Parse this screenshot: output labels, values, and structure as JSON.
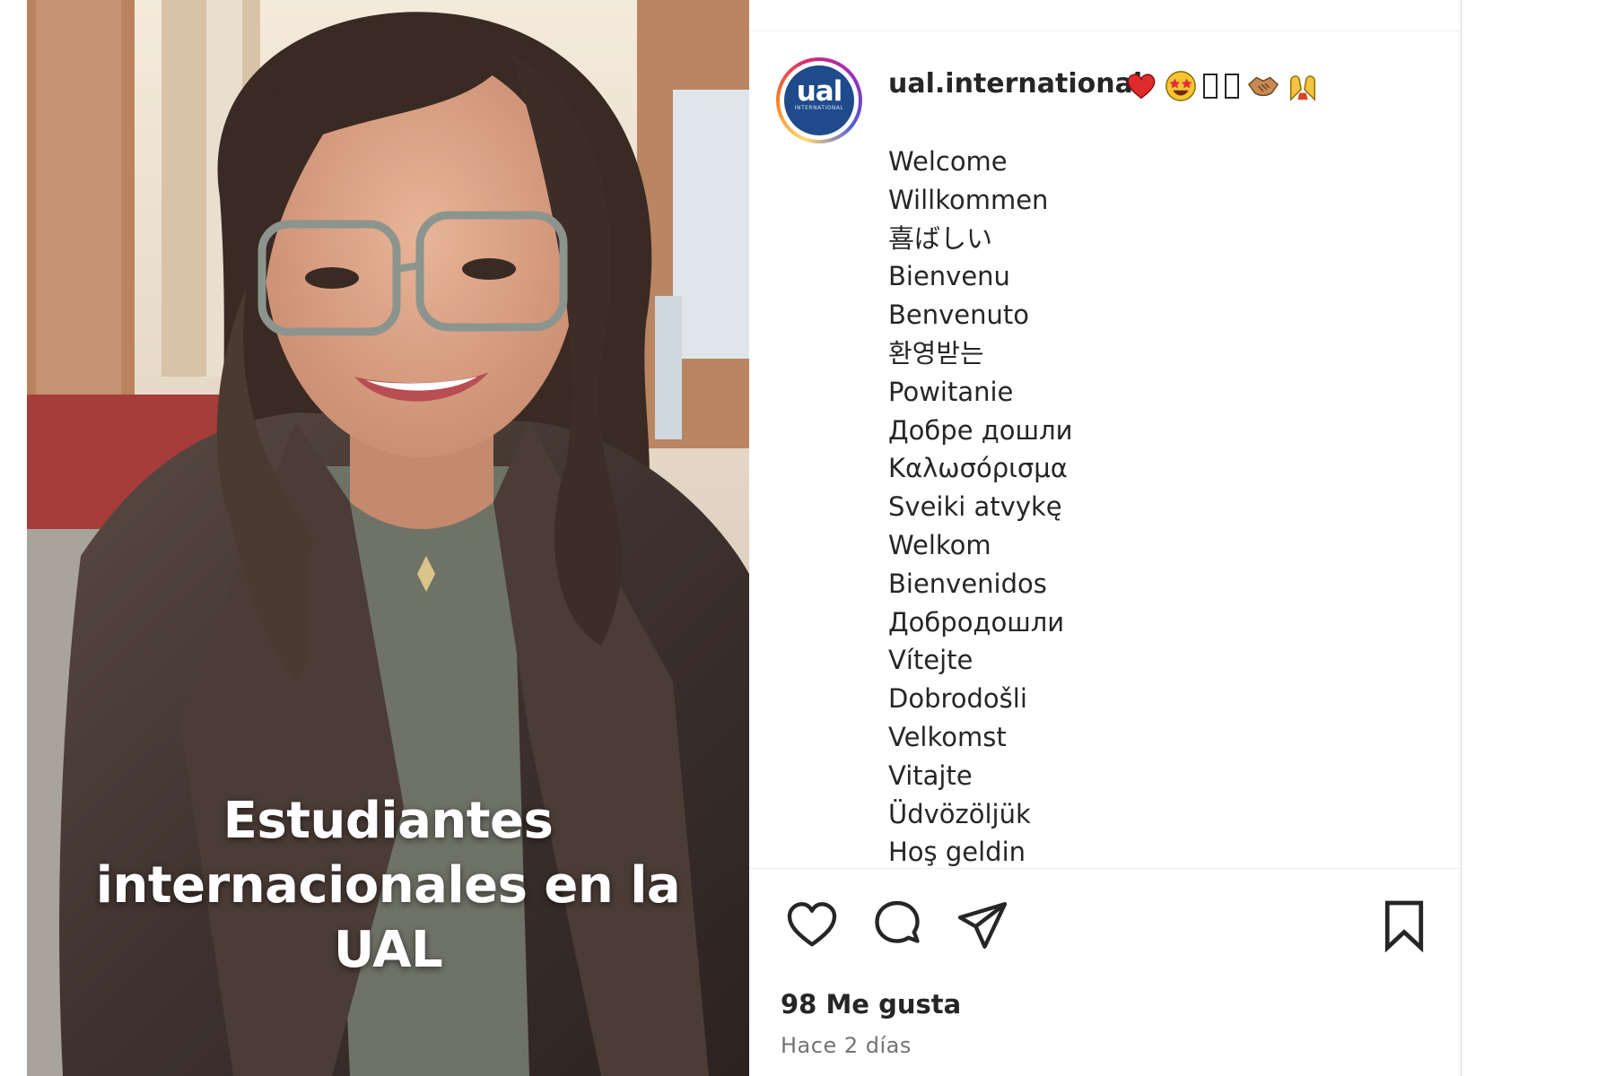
{
  "media": {
    "overlay_lines": [
      "Estudiantes",
      "internacionales en la",
      "UAL"
    ]
  },
  "post": {
    "username": "ual.international",
    "avatar": {
      "logo_text": "ual",
      "sub_text": "INTERNATIONAL"
    },
    "title_emojis": [
      "red-heart",
      "star-struck",
      "missing-glyph",
      "missing-glyph",
      "handshake",
      "raising-hands"
    ],
    "caption_lines": [
      "Welcome",
      "Willkommen",
      "喜ばしい",
      "Bienvenu",
      "Benvenuto",
      "환영받는",
      "Powitanie",
      "Добре дошли",
      "Καλωσόρισμα",
      "Sveiki atvykę",
      "Welkom",
      "Bienvenidos",
      "Добродошли",
      "Vítejte",
      "Dobrodošli",
      "Velkomst",
      "Vitajte",
      "Üdvözöljük",
      "Hoş geldin"
    ],
    "actions": [
      "heart-icon",
      "comment-icon",
      "share-icon",
      "bookmark-icon"
    ],
    "likes": "98 Me gusta",
    "timestamp": "Hace 2 días"
  },
  "colors": {
    "text": "#262626",
    "secondary_text": "#737373",
    "divider": "#efefef",
    "avatar_blue": "#1f4a8c"
  }
}
